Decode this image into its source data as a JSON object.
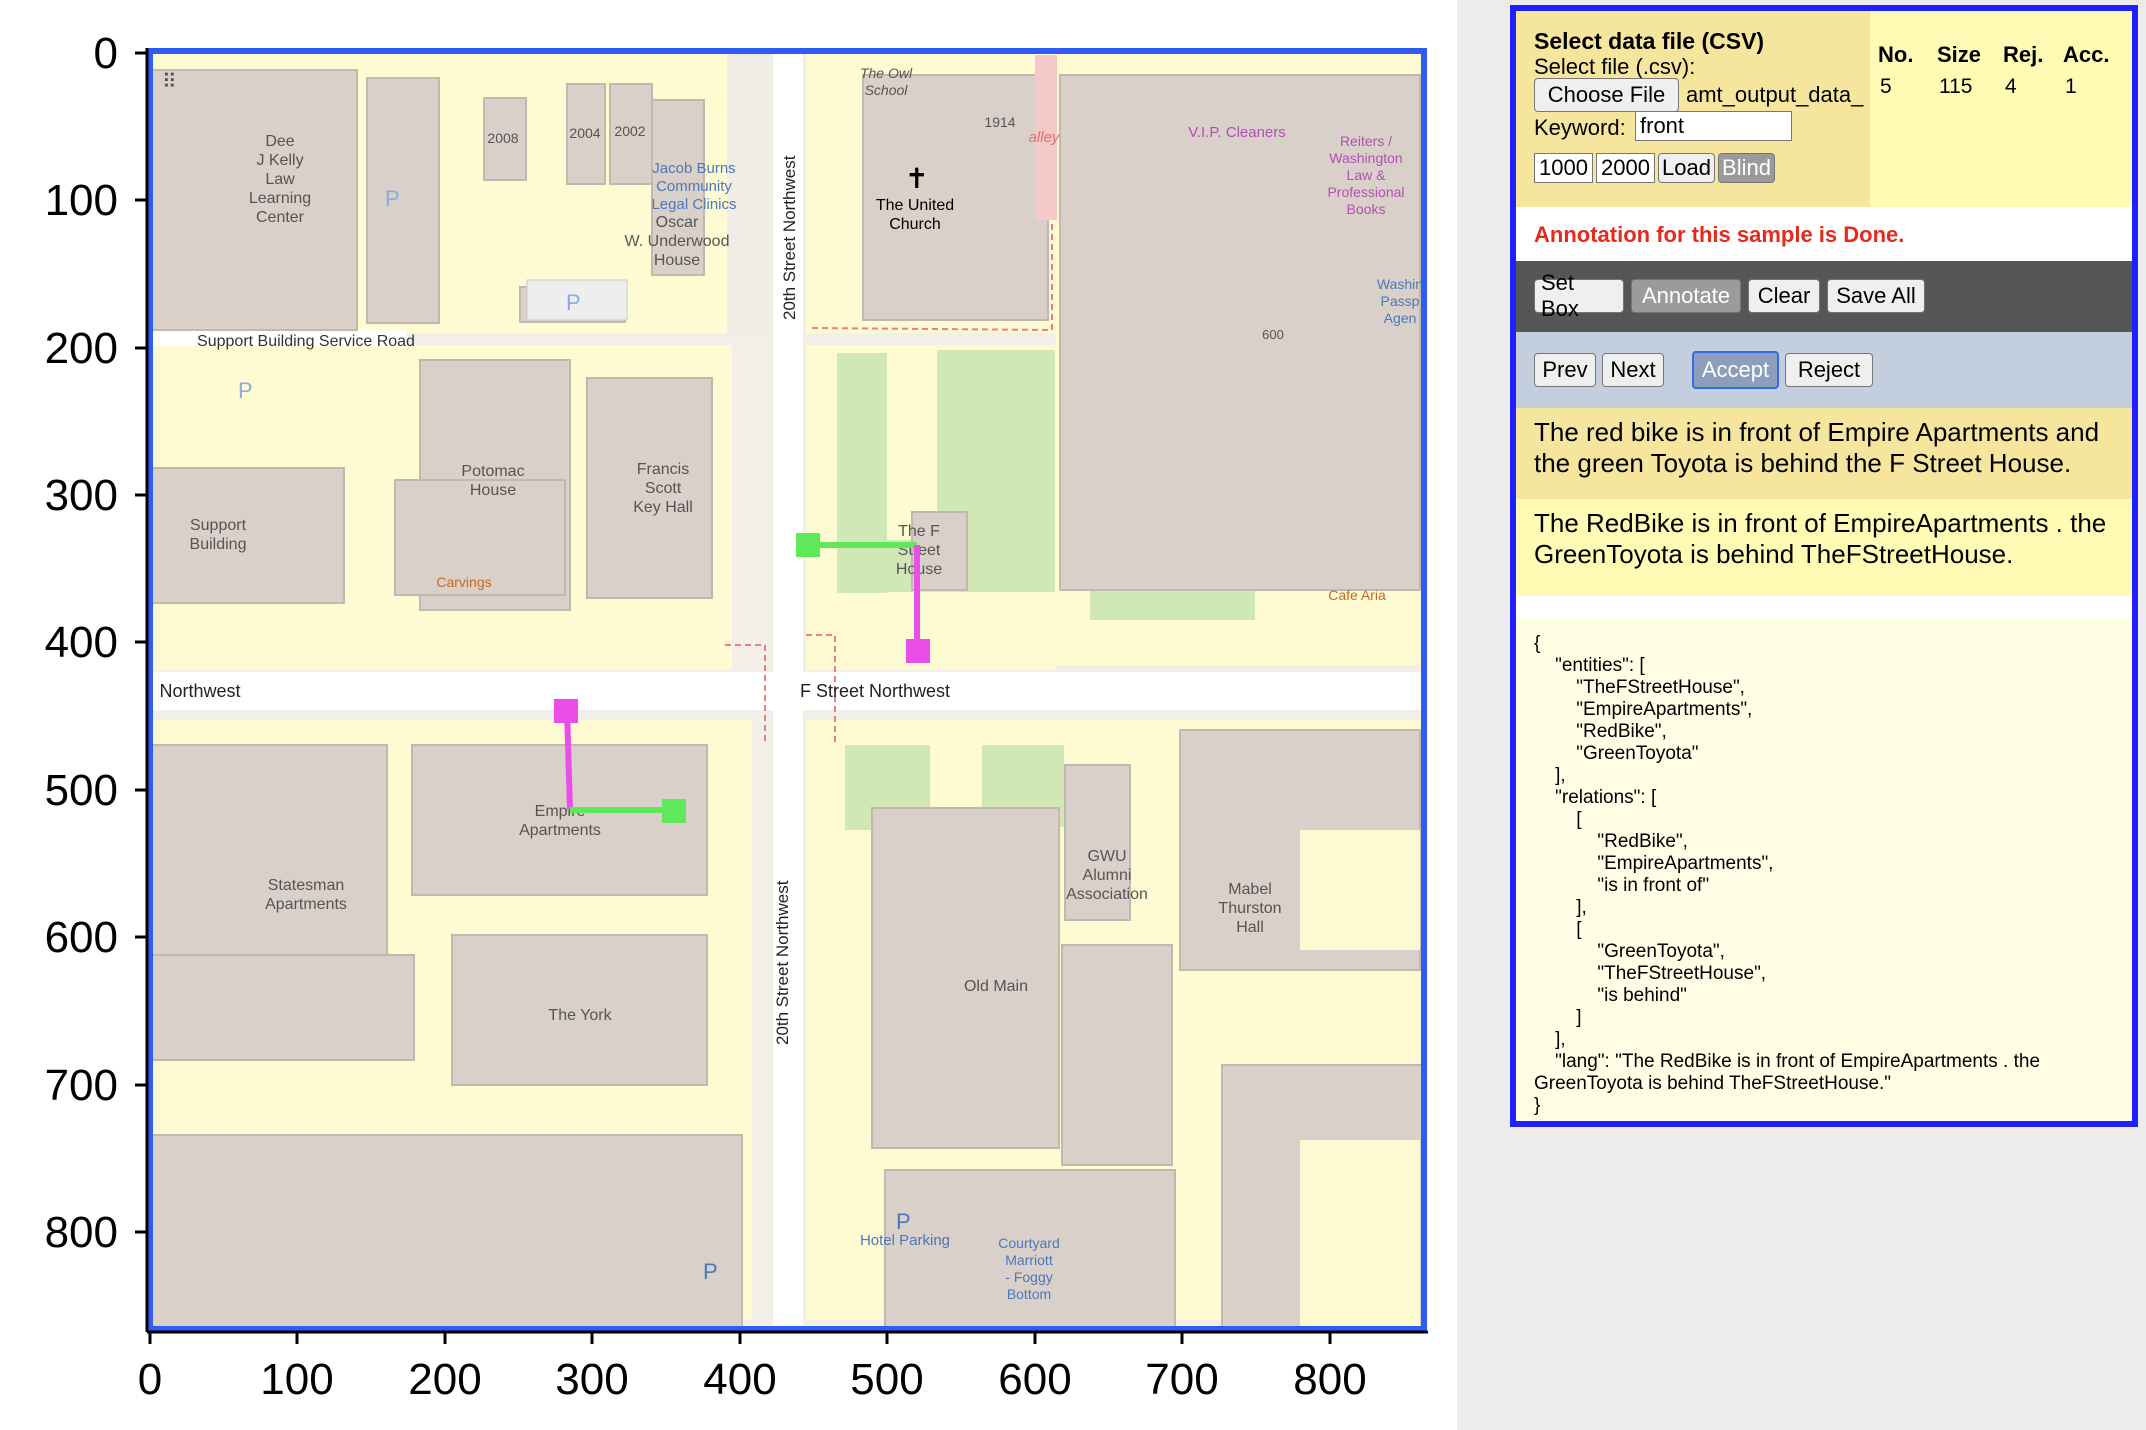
{
  "plot": {
    "y_ticks": [
      "0",
      "100",
      "200",
      "300",
      "400",
      "500",
      "600",
      "700",
      "800"
    ],
    "x_ticks": [
      "0",
      "100",
      "200",
      "300",
      "400",
      "500",
      "600",
      "700",
      "800"
    ]
  },
  "map": {
    "labels": {
      "dee_kelly": [
        "Dee",
        "J Kelly",
        "Law",
        "Learning",
        "Center"
      ],
      "y2008": "2008",
      "y2004": "2004",
      "y2002": "2002",
      "jacob_burns": [
        "Jacob Burns",
        "Community",
        "Legal Clinics"
      ],
      "oscar": [
        "Oscar",
        "W. Underwood",
        "House"
      ],
      "owl_school": [
        "The Owl",
        "School"
      ],
      "y1914": "1914",
      "alley": "alley",
      "united_church": [
        "The United",
        "Church"
      ],
      "vip_cleaners": "V.I.P. Cleaners",
      "reiters": [
        "Reiters /",
        "Washington",
        "Law &",
        "Professional",
        "Books"
      ],
      "washin": [
        "Washin",
        "Passp",
        "Agen"
      ],
      "y600": "600",
      "support_road": "Support Building Service Road",
      "potomac": [
        "Potomac",
        "House"
      ],
      "francis": [
        "Francis",
        "Scott",
        "Key Hall"
      ],
      "support_building": [
        "Support",
        "Building"
      ],
      "carvings": "Carvings",
      "street_vertical_top": "20th Street Northwest",
      "street_vertical_bottom": "20th Street Northwest",
      "ff_house": [
        "The F",
        "Street",
        "House"
      ],
      "cafe_aria": "Cafe Aria",
      "northwest_left": "Northwest",
      "f_street": "F Street Northwest",
      "empire": [
        "Empire",
        "Apartments"
      ],
      "statesman": [
        "Statesman",
        "Apartments"
      ],
      "gwu": [
        "GWU",
        "Alumni",
        "Association"
      ],
      "mabel": [
        "Mabel",
        "Thurston",
        "Hall"
      ],
      "old_main": "Old Main",
      "the_york": "The York",
      "hotel_parking": "Hotel Parking",
      "courtyard": [
        "Courtyard",
        "Marriott",
        "- Foggy",
        "Bottom"
      ],
      "p": "P"
    },
    "annotation_colors": {
      "green": "#5ee85a",
      "magenta": "#e94ee9"
    }
  },
  "panel": {
    "select_title": "Select data file (CSV)",
    "select_file_label": "Select file (.csv):",
    "choose_file_button": "Choose File",
    "file_name": "amt_output_data_",
    "keyword_label": "Keyword:",
    "keyword_value": "front",
    "range_start": "1000",
    "range_end": "2000",
    "load_button": "Load",
    "blind_button": "Blind",
    "stats": {
      "headers": [
        "No.",
        "Size",
        "Rej.",
        "Acc."
      ],
      "values": [
        "5",
        "115",
        "4",
        "1"
      ]
    },
    "status_message": "Annotation for this sample is Done.",
    "toolbar": {
      "set_box": "Set Box",
      "annotate": "Annotate",
      "clear": "Clear",
      "save_all": "Save All"
    },
    "nav": {
      "prev": "Prev",
      "next": "Next",
      "accept": "Accept",
      "reject": "Reject"
    },
    "sentence_original": "The red bike is in front of Empire Apartments and the green Toyota is behind the F Street House.",
    "sentence_processed": "The RedBike is in front of EmpireApartments . the GreenToyota is behind TheFStreetHouse.",
    "json_output": "{\n    \"entities\": [\n        \"TheFStreetHouse\",\n        \"EmpireApartments\",\n        \"RedBike\",\n        \"GreenToyota\"\n    ],\n    \"relations\": [\n        [\n            \"RedBike\",\n            \"EmpireApartments\",\n            \"is in front of\"\n        ],\n        [\n            \"GreenToyota\",\n            \"TheFStreetHouse\",\n            \"is behind\"\n        ]\n    ],\n    \"lang\": \"The RedBike is in front of EmpireApartments . the GreenToyota is behind TheFStreetHouse.\"\n}"
  },
  "colors": {
    "accent_border": "#2f5cf5",
    "panel_border": "#1f1fff",
    "status_red": "#e52a1c"
  }
}
